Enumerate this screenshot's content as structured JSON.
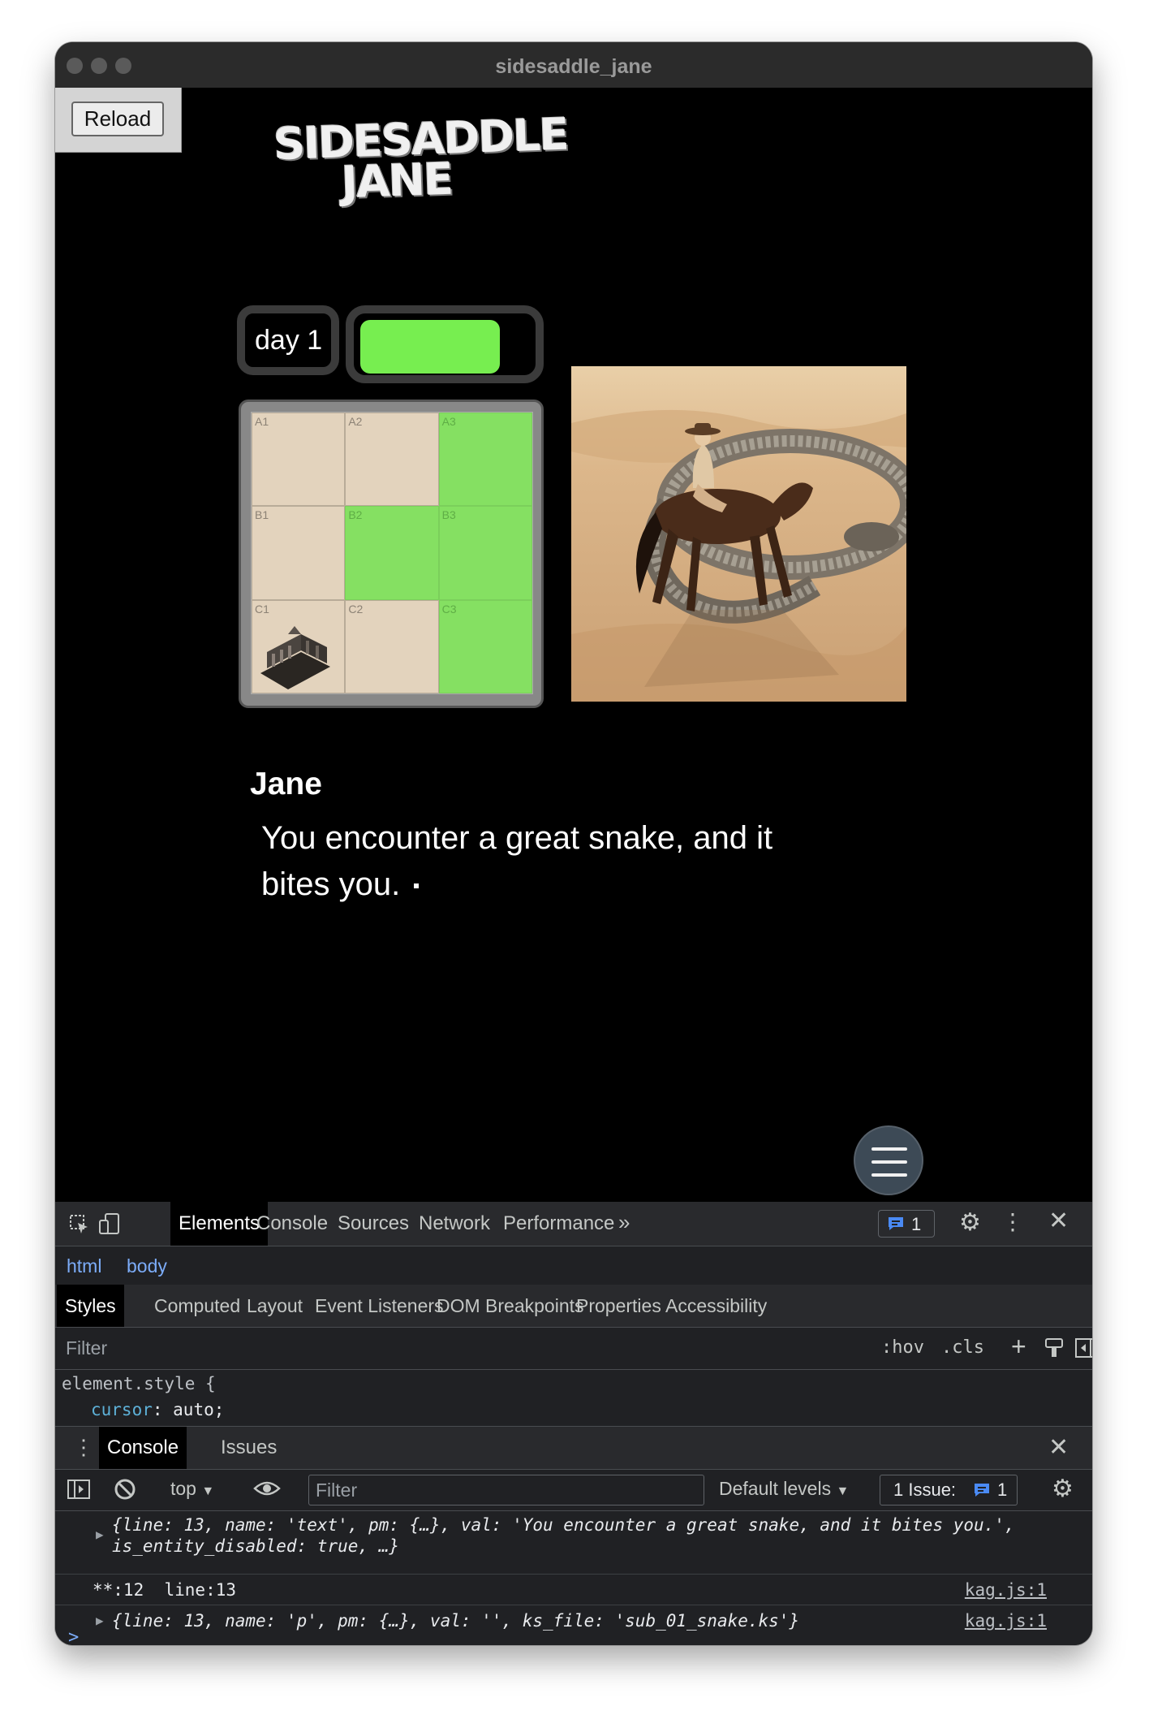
{
  "window": {
    "title": "sidesaddle_jane"
  },
  "game": {
    "reload_label": "Reload",
    "logo_line1": "SIDESADDLE",
    "logo_line2": "JANE",
    "day_label": "day 1",
    "health_level": 0.82,
    "health_color": "#77ee50",
    "map": {
      "cells": [
        {
          "label": "A1",
          "active": false
        },
        {
          "label": "A2",
          "active": false
        },
        {
          "label": "A3",
          "active": true
        },
        {
          "label": "B1",
          "active": false
        },
        {
          "label": "B2",
          "active": true
        },
        {
          "label": "B3",
          "active": true
        },
        {
          "label": "C1",
          "active": false,
          "icon": "ruin-icon"
        },
        {
          "label": "C2",
          "active": false
        },
        {
          "label": "C3",
          "active": true
        }
      ]
    },
    "speaker": "Jane",
    "message": "You encounter a great snake, and it bites you.",
    "menu_icon": "hamburger-icon"
  },
  "devtools": {
    "tabs": [
      "Elements",
      "Console",
      "Sources",
      "Network",
      "Performance"
    ],
    "active_tab": "Elements",
    "more_icon": "chevron-double-right-icon",
    "issues_count": "1",
    "breadcrumbs": [
      "html",
      "body"
    ],
    "style_tabs": [
      "Styles",
      "Computed",
      "Layout",
      "Event Listeners",
      "DOM Breakpoints",
      "Properties",
      "Accessibility"
    ],
    "filter_placeholder": "Filter",
    "hov": ":hov",
    "cls": ".cls",
    "element_style_selector": "element.style {",
    "element_style_prop": "cursor",
    "element_style_value": "auto;",
    "drawer_tabs": [
      "Console",
      "Issues"
    ],
    "console_context": "top",
    "console_filter_placeholder": "Filter",
    "default_levels": "Default levels",
    "issue_label": "1 Issue:",
    "issue_count": "1",
    "logs": [
      {
        "line1": "{line: 13, name: 'text', pm: {…}, val: 'You encounter a great snake, and it bites you.',",
        "line2": "is_entity_disabled: true, …}"
      },
      {
        "text": "**:12  line:13",
        "source": "kag.js:1"
      },
      {
        "text": "{line: 13, name: 'p', pm: {…}, val: '', ks_file: 'sub_01_snake.ks'}",
        "source": "kag.js:1"
      }
    ],
    "prompt": ">"
  }
}
